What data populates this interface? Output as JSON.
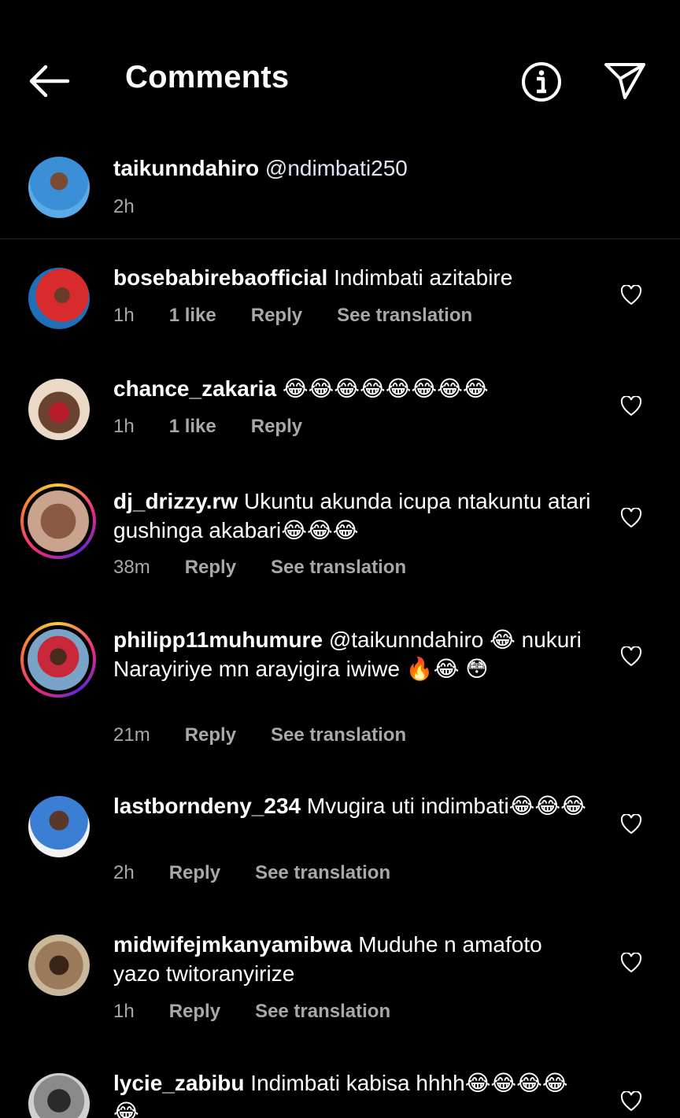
{
  "header": {
    "title": "Comments"
  },
  "caption": {
    "username": "taikunndahiro",
    "text": "@ndimbati250",
    "time": "2h"
  },
  "comments": [
    {
      "username": "bosebabirebaofficial",
      "text": "Indimbati azitabire",
      "time": "1h",
      "likes": "1 like",
      "reply": "Reply",
      "translate": "See translation"
    },
    {
      "username": "chance_zakaria",
      "text": "😂😂😂😂😂😂😂😂",
      "time": "1h",
      "likes": "1 like",
      "reply": "Reply"
    },
    {
      "username": "dj_drizzy.rw",
      "text": "Ukuntu akunda icupa ntakuntu atari gushinga akabari😂😂😂",
      "time": "38m",
      "reply": "Reply",
      "translate": "See translation"
    },
    {
      "username": "philipp11muhumure",
      "text": "@taikunndahiro 😂 nukuri Narayiriye mn arayigira iwiwe 🔥😂 😳",
      "time": "21m",
      "reply": "Reply",
      "translate": "See translation"
    },
    {
      "username": "lastborndeny_234",
      "text": "Mvugira uti indimbati😂😂😂",
      "time": "2h",
      "reply": "Reply",
      "translate": "See translation"
    },
    {
      "username": "midwifejmkanyamibwa",
      "text": "Muduhe n amafoto yazo twitoranyirize",
      "time": "1h",
      "reply": "Reply",
      "translate": "See translation"
    },
    {
      "username": "lycie_zabibu",
      "text": "Indimbati kabisa hhhh😂😂😂😂😂",
      "time": "",
      "reply": ""
    }
  ],
  "colors": {
    "background": "#000000",
    "text": "#ffffff",
    "secondary": "#a8a8a8",
    "divider": "#262626"
  }
}
